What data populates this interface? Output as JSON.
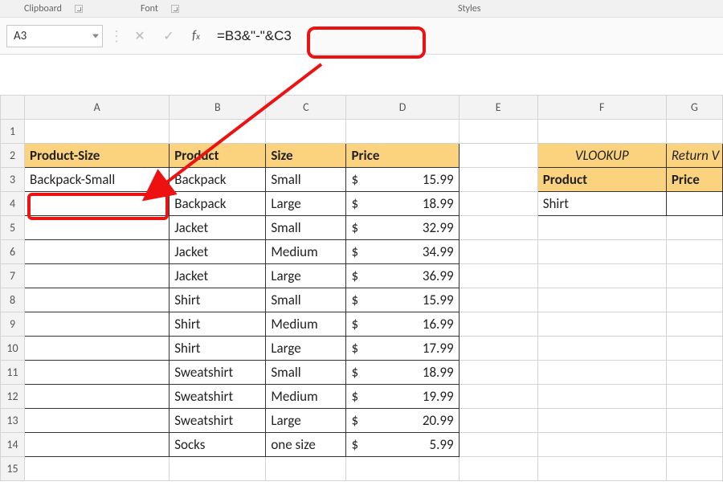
{
  "ribbon": {
    "clipboard": "Clipboard",
    "font": "Font",
    "styles": "Styles"
  },
  "namebox": {
    "value": "A3"
  },
  "formula": {
    "value": "=B3&\"-\"&C3"
  },
  "cols": {
    "A": "A",
    "B": "B",
    "C": "C",
    "D": "D",
    "E": "E",
    "F": "F",
    "G": "G"
  },
  "rows": [
    "1",
    "2",
    "3",
    "4",
    "5",
    "6",
    "7",
    "8",
    "9",
    "10",
    "11",
    "12",
    "13",
    "14",
    "15"
  ],
  "headers": {
    "A": "Product-Size",
    "B": "Product",
    "C": "Size",
    "D": "Price"
  },
  "vlookup": {
    "title": "VLOOKUP",
    "ret": "Return V",
    "product_h": "Product",
    "price_h": "Price",
    "product_v": "Shirt"
  },
  "table": [
    {
      "a": "Backpack-Small",
      "b": "Backpack",
      "c": "Small",
      "cur": "$",
      "p": "15.99"
    },
    {
      "a": "",
      "b": "Backpack",
      "c": "Large",
      "cur": "$",
      "p": "18.99"
    },
    {
      "a": "",
      "b": "Jacket",
      "c": "Small",
      "cur": "$",
      "p": "32.99"
    },
    {
      "a": "",
      "b": "Jacket",
      "c": "Medium",
      "cur": "$",
      "p": "34.99"
    },
    {
      "a": "",
      "b": "Jacket",
      "c": "Large",
      "cur": "$",
      "p": "36.99"
    },
    {
      "a": "",
      "b": "Shirt",
      "c": "Small",
      "cur": "$",
      "p": "15.99"
    },
    {
      "a": "",
      "b": "Shirt",
      "c": "Medium",
      "cur": "$",
      "p": "16.99"
    },
    {
      "a": "",
      "b": "Shirt",
      "c": "Large",
      "cur": "$",
      "p": "17.99"
    },
    {
      "a": "",
      "b": "Sweatshirt",
      "c": "Small",
      "cur": "$",
      "p": "18.99"
    },
    {
      "a": "",
      "b": "Sweatshirt",
      "c": "Medium",
      "cur": "$",
      "p": "19.99"
    },
    {
      "a": "",
      "b": "Sweatshirt",
      "c": "Large",
      "cur": "$",
      "p": "20.99"
    },
    {
      "a": "",
      "b": "Socks",
      "c": "one size",
      "cur": "$",
      "p": "5.99"
    }
  ]
}
